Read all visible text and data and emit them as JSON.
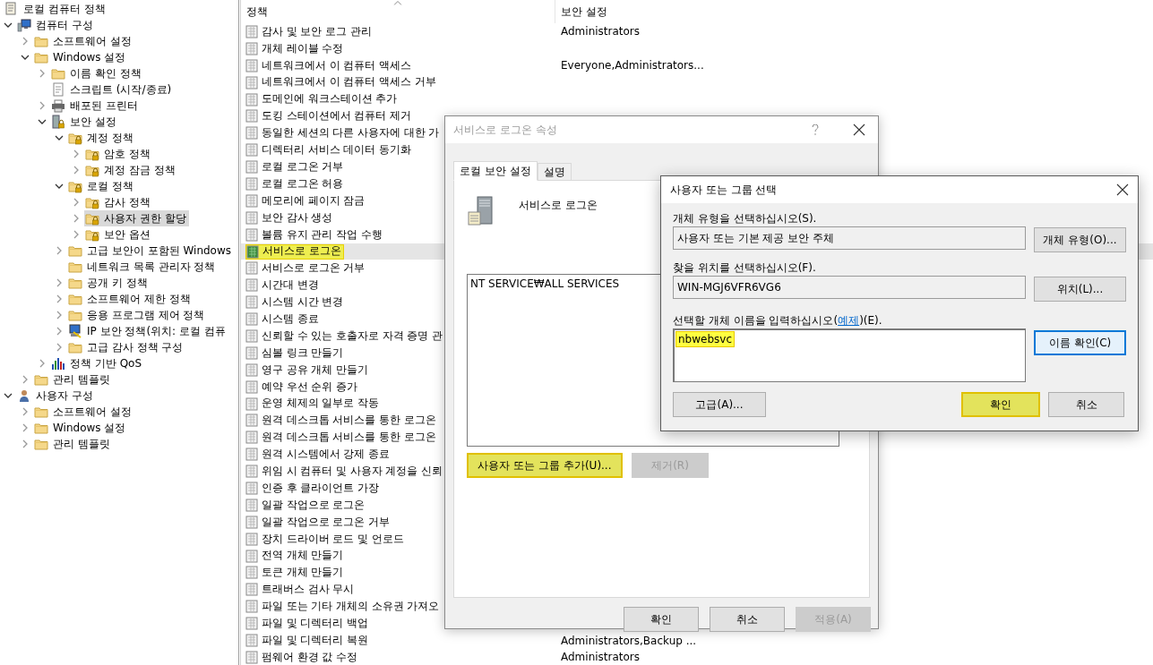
{
  "tree": {
    "root": {
      "label": "로컬 컴퓨터 정책"
    },
    "items": [
      {
        "label": "컴퓨터 구성",
        "kind": "computer",
        "expanded": true,
        "selected": false,
        "children": [
          {
            "label": "소프트웨어 설정",
            "kind": "folder",
            "expanded": false,
            "selected": false
          },
          {
            "label": "Windows 설정",
            "kind": "folder",
            "expanded": true,
            "selected": false,
            "children": [
              {
                "label": "이름 확인 정책",
                "kind": "folder",
                "expanded": false,
                "selected": false
              },
              {
                "label": "스크립트 (시작/종료)",
                "kind": "script",
                "selected": false
              },
              {
                "label": "배포된 프린터",
                "kind": "printer",
                "expanded": false,
                "selected": false
              },
              {
                "label": "보안 설정",
                "kind": "security",
                "expanded": true,
                "selected": false,
                "children": [
                  {
                    "label": "계정 정책",
                    "kind": "lock-folder",
                    "expanded": true,
                    "selected": false,
                    "children": [
                      {
                        "label": "암호 정책",
                        "kind": "lock-folder",
                        "expanded": false,
                        "selected": false
                      },
                      {
                        "label": "계정 잠금 정책",
                        "kind": "lock-folder",
                        "expanded": false,
                        "selected": false
                      }
                    ]
                  },
                  {
                    "label": "로컬 정책",
                    "kind": "lock-folder",
                    "expanded": true,
                    "selected": false,
                    "children": [
                      {
                        "label": "감사 정책",
                        "kind": "lock-folder",
                        "expanded": false,
                        "selected": false
                      },
                      {
                        "label": "사용자 권한 할당",
                        "kind": "lock-folder",
                        "expanded": false,
                        "selected": true
                      },
                      {
                        "label": "보안 옵션",
                        "kind": "lock-folder",
                        "expanded": false,
                        "selected": false
                      }
                    ]
                  },
                  {
                    "label": "고급 보안이 포함된 Windows",
                    "kind": "folder",
                    "expanded": false,
                    "selected": false
                  },
                  {
                    "label": "네트워크 목록 관리자 정책",
                    "kind": "folder",
                    "selected": false
                  },
                  {
                    "label": "공개 키 정책",
                    "kind": "folder",
                    "expanded": false,
                    "selected": false
                  },
                  {
                    "label": "소프트웨어 제한 정책",
                    "kind": "folder",
                    "expanded": false,
                    "selected": false
                  },
                  {
                    "label": "응용 프로그램 제어 정책",
                    "kind": "folder",
                    "expanded": false,
                    "selected": false
                  },
                  {
                    "label": "IP 보안 정책(위치: 로컬 컴퓨",
                    "kind": "ip",
                    "expanded": false,
                    "selected": false
                  },
                  {
                    "label": "고급 감사 정책 구성",
                    "kind": "folder",
                    "expanded": false,
                    "selected": false
                  }
                ]
              },
              {
                "label": "정책 기반 QoS",
                "kind": "chart",
                "expanded": false,
                "selected": false
              }
            ]
          },
          {
            "label": "관리 템플릿",
            "kind": "folder",
            "expanded": false,
            "selected": false
          }
        ]
      },
      {
        "label": "사용자 구성",
        "kind": "user",
        "expanded": true,
        "selected": false,
        "children": [
          {
            "label": "소프트웨어 설정",
            "kind": "folder",
            "expanded": false,
            "selected": false
          },
          {
            "label": "Windows 설정",
            "kind": "folder",
            "expanded": false,
            "selected": false
          },
          {
            "label": "관리 템플릿",
            "kind": "folder",
            "expanded": false,
            "selected": false
          }
        ]
      }
    ]
  },
  "policy_list": {
    "columns": [
      {
        "label": "정책",
        "sorted": true
      },
      {
        "label": "보안 설정",
        "sorted": false
      }
    ],
    "rows": [
      {
        "policy": "감사 및 보안 로그 관리",
        "setting": "Administrators",
        "selected": false,
        "highlighted": false
      },
      {
        "policy": "개체 레이블 수정",
        "selected": false,
        "highlighted": false
      },
      {
        "policy": "네트워크에서 이 컴퓨터 액세스",
        "setting": "Everyone,Administrators...",
        "selected": false,
        "highlighted": false
      },
      {
        "policy": "네트워크에서 이 컴퓨터 액세스 거부",
        "selected": false,
        "highlighted": false
      },
      {
        "policy": "도메인에 워크스테이션 추가",
        "selected": false,
        "highlighted": false
      },
      {
        "policy": "도킹 스테이션에서 컴퓨터 제거",
        "selected": false,
        "highlighted": false
      },
      {
        "policy": "동일한 세션의 다른 사용자에 대한 가",
        "selected": false,
        "highlighted": false
      },
      {
        "policy": "디렉터리 서비스 데이터 동기화",
        "selected": false,
        "highlighted": false
      },
      {
        "policy": "로컬 로그온 거부",
        "selected": false,
        "highlighted": false
      },
      {
        "policy": "로컬 로그온 허용",
        "selected": false,
        "highlighted": false
      },
      {
        "policy": "메모리에 페이지 잠금",
        "selected": false,
        "highlighted": false
      },
      {
        "policy": "보안 감사 생성",
        "selected": false,
        "highlighted": false
      },
      {
        "policy": "볼륨 유지 관리 작업 수행",
        "selected": false,
        "highlighted": false
      },
      {
        "policy": "서비스로 로그온",
        "selected": true,
        "highlighted": true
      },
      {
        "policy": "서비스로 로그온 거부",
        "selected": false,
        "highlighted": false
      },
      {
        "policy": "시간대 변경",
        "selected": false,
        "highlighted": false
      },
      {
        "policy": "시스템 시간 변경",
        "selected": false,
        "highlighted": false
      },
      {
        "policy": "시스템 종료",
        "selected": false,
        "highlighted": false
      },
      {
        "policy": "신뢰할 수 있는 호출자로 자격 증명 관",
        "selected": false,
        "highlighted": false
      },
      {
        "policy": "심볼 링크 만들기",
        "selected": false,
        "highlighted": false
      },
      {
        "policy": "영구 공유 개체 만들기",
        "selected": false,
        "highlighted": false
      },
      {
        "policy": "예약 우선 순위 증가",
        "selected": false,
        "highlighted": false
      },
      {
        "policy": "운영 체제의 일부로 작동",
        "selected": false,
        "highlighted": false
      },
      {
        "policy": "원격 데스크톱 서비스를 통한 로그온",
        "selected": false,
        "highlighted": false
      },
      {
        "policy": "원격 데스크톱 서비스를 통한 로그온",
        "selected": false,
        "highlighted": false
      },
      {
        "policy": "원격 시스템에서 강제 종료",
        "selected": false,
        "highlighted": false
      },
      {
        "policy": "위임 시 컴퓨터 및 사용자 계정을 신뢰",
        "selected": false,
        "highlighted": false
      },
      {
        "policy": "인증 후 클라이언트 가장",
        "selected": false,
        "highlighted": false
      },
      {
        "policy": "일괄 작업으로 로그온",
        "selected": false,
        "highlighted": false
      },
      {
        "policy": "일괄 작업으로 로그온 거부",
        "selected": false,
        "highlighted": false
      },
      {
        "policy": "장치 드라이버 로드 및 언로드",
        "selected": false,
        "highlighted": false
      },
      {
        "policy": "전역 개체 만들기",
        "selected": false,
        "highlighted": false
      },
      {
        "policy": "토큰 개체 만들기",
        "selected": false,
        "highlighted": false
      },
      {
        "policy": "트래버스 검사 무시",
        "selected": false,
        "highlighted": false
      },
      {
        "policy": "파일 또는 기타 개체의 소유권 가져오",
        "selected": false,
        "highlighted": false
      },
      {
        "policy": "파일 및 디렉터리 백업",
        "selected": false,
        "highlighted": false
      },
      {
        "policy": "파일 및 디렉터리 복원",
        "setting": "Administrators,Backup ...",
        "selected": false,
        "highlighted": false
      },
      {
        "policy": "펌웨어 환경 값 수정",
        "setting": "Administrators",
        "selected": false,
        "highlighted": false
      }
    ]
  },
  "properties_dialog": {
    "title": "서비스로 로그온 속성",
    "tabs": [
      {
        "label": "로컬 보안 설정",
        "selected": true
      },
      {
        "label": "설명",
        "selected": false
      }
    ],
    "policy_name": "서비스로 로그온",
    "members": [
      "NT SERVICE₩ALL SERVICES"
    ],
    "buttons": [
      {
        "label": "사용자 또는 그룹 추가(U)...",
        "highlighted": true,
        "disabled": false
      },
      {
        "label": "제거(R)",
        "highlighted": false,
        "disabled": true
      }
    ],
    "footer_buttons": [
      {
        "label": "확인",
        "disabled": false
      },
      {
        "label": "취소",
        "disabled": false
      },
      {
        "label": "적용(A)",
        "disabled": true
      }
    ]
  },
  "select_dialog": {
    "title": "사용자 또는 그룹 선택",
    "object_type": {
      "label": "개체 유형을 선택하십시오(S).",
      "value": "사용자 또는 기본 제공 보안 주체",
      "button": {
        "label": "개체 유형(O)..."
      }
    },
    "location": {
      "label": "찾을 위치를 선택하십시오(F).",
      "value": "WIN-MGJ6VFR6VG6",
      "button": {
        "label": "위치(L)..."
      }
    },
    "names": {
      "label_before": "선택할 개체 이름을 입력하십시오(",
      "link": "예제",
      "label_after": ")(E).",
      "value": "nbwebsvc",
      "highlighted": true,
      "button": {
        "label": "이름 확인(C)",
        "focused": true
      }
    },
    "buttons": [
      {
        "label": "고급(A)...",
        "highlighted": false
      },
      {
        "label": "확인",
        "highlighted": true
      },
      {
        "label": "취소",
        "highlighted": false
      }
    ]
  }
}
